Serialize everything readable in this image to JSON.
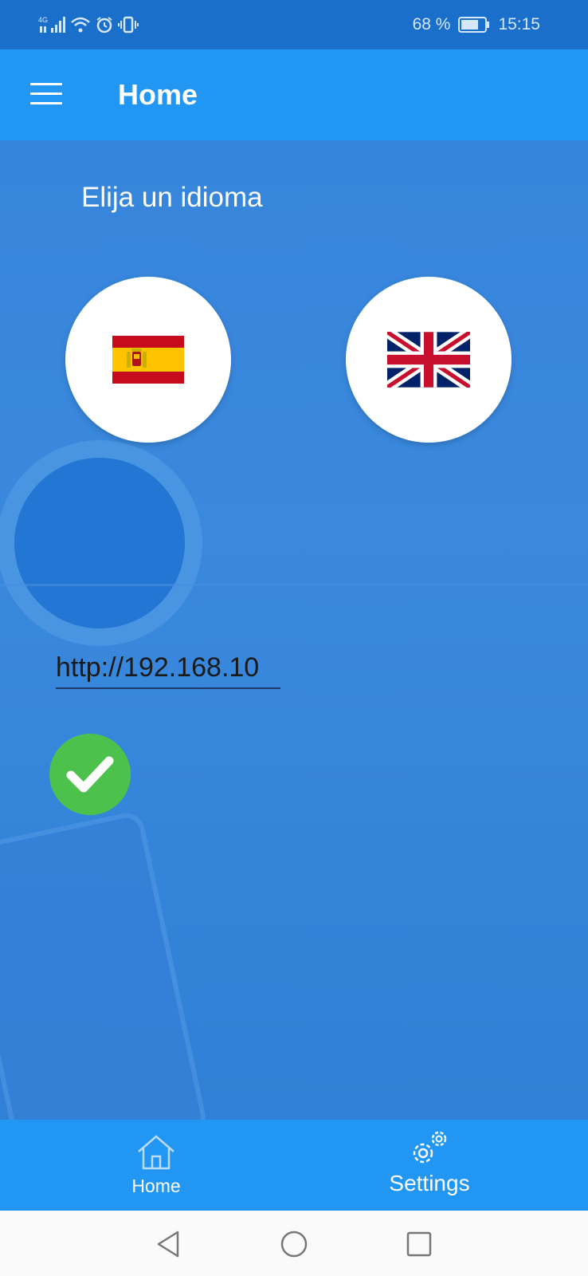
{
  "status_bar": {
    "network": "4G",
    "battery_percent": "68 %",
    "time": "15:15"
  },
  "app_bar": {
    "title": "Home",
    "menu_icon": "hamburger-menu-icon"
  },
  "main": {
    "prompt": "Elija un idioma",
    "languages": [
      {
        "icon": "spain-flag-icon"
      },
      {
        "icon": "uk-flag-icon"
      }
    ],
    "server_url": {
      "value": "http://192.168.10"
    },
    "confirm_icon": "checkmark-icon"
  },
  "bottom_nav": {
    "items": [
      {
        "label": "Home",
        "icon": "house-icon"
      },
      {
        "label": "Settings",
        "icon": "gears-icon"
      }
    ]
  },
  "system_nav": {
    "icons": [
      "back-triangle-icon",
      "home-circle-icon",
      "recents-square-icon"
    ]
  },
  "colors": {
    "status_bar": "#1a6fcb",
    "app_bar": "#2196f3",
    "content_bg": "#3685dc",
    "confirm_green": "#4cc24c",
    "system_nav_bg": "#fafafa"
  }
}
